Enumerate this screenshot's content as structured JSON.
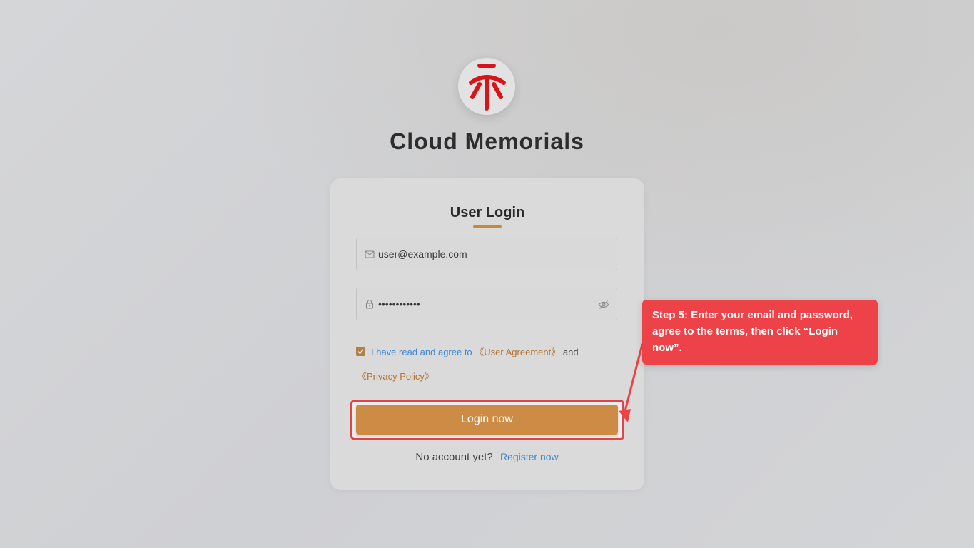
{
  "brand": {
    "app_title": "Cloud Memorials",
    "logo_icon": "memorial-glyph-icon",
    "logo_color": "#d8141b"
  },
  "login_card": {
    "title": "User Login",
    "email": {
      "value": "user@example.com",
      "icon": "mail-icon"
    },
    "password": {
      "value": "••••••••••••",
      "icon": "lock-icon",
      "toggle_icon": "eye-off-icon"
    },
    "agreement": {
      "checked": true,
      "prefix": "I have read and agree to",
      "user_agreement": "《User Agreement》",
      "conjunction": "and",
      "privacy_policy": "《Privacy Policy》"
    },
    "login_button_label": "Login now",
    "register_prompt": "No account yet?",
    "register_link": "Register now"
  },
  "tutorial": {
    "callout_text": "Step 5: Enter your email and password, agree to the terms, then click “Login now”.",
    "highlight_color": "#e0434a"
  },
  "colors": {
    "accent": "#cc8c45",
    "link_blue": "#3b87d6",
    "link_brown": "#b5722e",
    "callout_red": "#ed4247"
  }
}
